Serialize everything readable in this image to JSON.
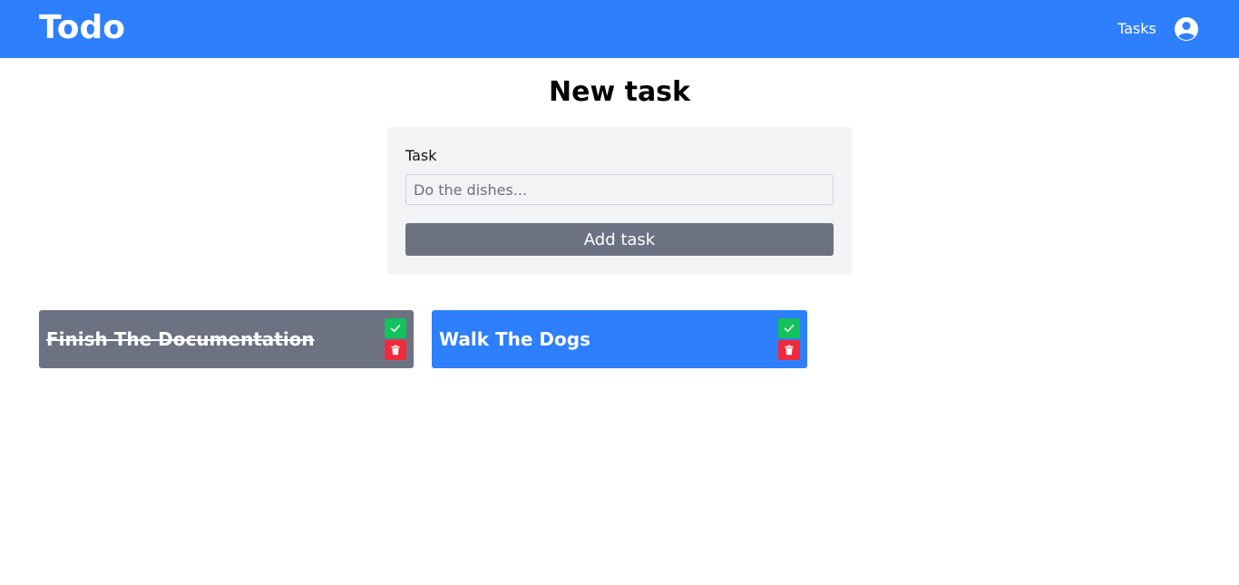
{
  "navbar": {
    "brand": "Todo",
    "links": [
      {
        "label": "Tasks"
      }
    ],
    "user_icon": "user-circle-icon",
    "color": "#2d7ffc"
  },
  "main": {
    "title": "New task",
    "form": {
      "label": "Task",
      "input": {
        "value": "",
        "placeholder": "Do the dishes..."
      },
      "submit_label": "Add task"
    },
    "tasks": [
      {
        "title": "Finish The Documentation",
        "completed": true,
        "color": "#6c7281"
      },
      {
        "title": "Walk The Dogs",
        "completed": false,
        "color": "#2d7ffc"
      }
    ],
    "task_actions": {
      "complete_icon": "check-icon",
      "complete_color": "#13c25a",
      "delete_icon": "trash-icon",
      "delete_color": "#f02a3a"
    }
  }
}
